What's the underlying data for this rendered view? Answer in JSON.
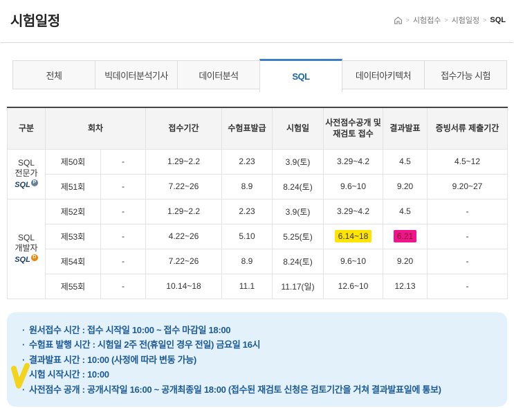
{
  "page_title": "시험일정",
  "breadcrumb": {
    "separator": ">",
    "items": [
      "시험접수",
      "시험일정",
      "SQL"
    ]
  },
  "tabs": [
    {
      "label": "전체",
      "active": false
    },
    {
      "label": "빅데이터분석기사",
      "active": false
    },
    {
      "label": "데이터분석",
      "active": false
    },
    {
      "label": "SQL",
      "active": true
    },
    {
      "label": "데이터아키텍처",
      "active": false
    },
    {
      "label": "접수가능 시험",
      "active": false
    }
  ],
  "table": {
    "headers": {
      "category": "구분",
      "session": "회차",
      "registration_period": "접수기간",
      "admission_ticket": "수험표발급",
      "exam_date": "시험일",
      "pre_score": "사전점수공개 및 재검토 접수",
      "result": "결과발표",
      "documents": "증빙서류 제출기간"
    },
    "groups": [
      {
        "name": "SQL 전문가",
        "logo_text": "SQL",
        "logo_badge": "P"
      },
      {
        "name": "SQL 개발자",
        "logo_text": "SQL",
        "logo_badge": "D"
      }
    ],
    "rows": [
      {
        "session": "제50회",
        "round_note": "-",
        "registration": "1.29~2.2",
        "ticket": "2.23",
        "exam_date": "3.9(토)",
        "pre_score": "3.29~4.2",
        "result": "4.5",
        "documents": "4.5~12"
      },
      {
        "session": "제51회",
        "round_note": "-",
        "registration": "7.22~26",
        "ticket": "8.9",
        "exam_date": "8.24(토)",
        "pre_score": "9.6~10",
        "result": "9.20",
        "documents": "9.20~27"
      },
      {
        "session": "제52회",
        "round_note": "-",
        "registration": "1.29~2.2",
        "ticket": "2.23",
        "exam_date": "3.9(토)",
        "pre_score": "3.29~4.2",
        "result": "4.5",
        "documents": "-"
      },
      {
        "session": "제53회",
        "round_note": "-",
        "registration": "4.22~26",
        "ticket": "5.10",
        "exam_date": "5.25(토)",
        "pre_score": "6.14~18",
        "result": "6.21",
        "documents": "-"
      },
      {
        "session": "제54회",
        "round_note": "-",
        "registration": "7.22~26",
        "ticket": "8.9",
        "exam_date": "8.24(토)",
        "pre_score": "9.6~10",
        "result": "9.20",
        "documents": "-"
      },
      {
        "session": "제55회",
        "round_note": "-",
        "registration": "10.14~18",
        "ticket": "11.1",
        "exam_date": "11.17(일)",
        "pre_score": "12.6~10",
        "result": "12.13",
        "documents": "-"
      }
    ]
  },
  "notes_bullet": "·",
  "notes": [
    "원서접수 시간 : 접수 시작일 10:00 ~ 접수 마감일 18:00",
    "수험표 발행 시간 : 시험일 2주 전(휴일인 경우 전일) 금요일 16시",
    "결과발표 시간 : 10:00 (사정에 따라 변동 가능)",
    "시험 시작시간 : 10:00",
    "사전점수 공개 : 공개시작일 16:00 ~ 공개최종일 18:00 (접수된 재검토 신청은 검토기간을 거쳐 결과발표일에 통보)"
  ],
  "colors": {
    "tab_active_accent": "#3f7ec4",
    "tab_active_text": "#1b64af",
    "highlight_yellow": "#ffe400",
    "highlight_pink": "#f0148c",
    "notes_background": "#e3f1fa",
    "notes_text": "#1c5a96",
    "sqlp_badge": "#64809c",
    "sqld_badge": "#f08300",
    "check_mark_yellow": "#f2d41f"
  }
}
